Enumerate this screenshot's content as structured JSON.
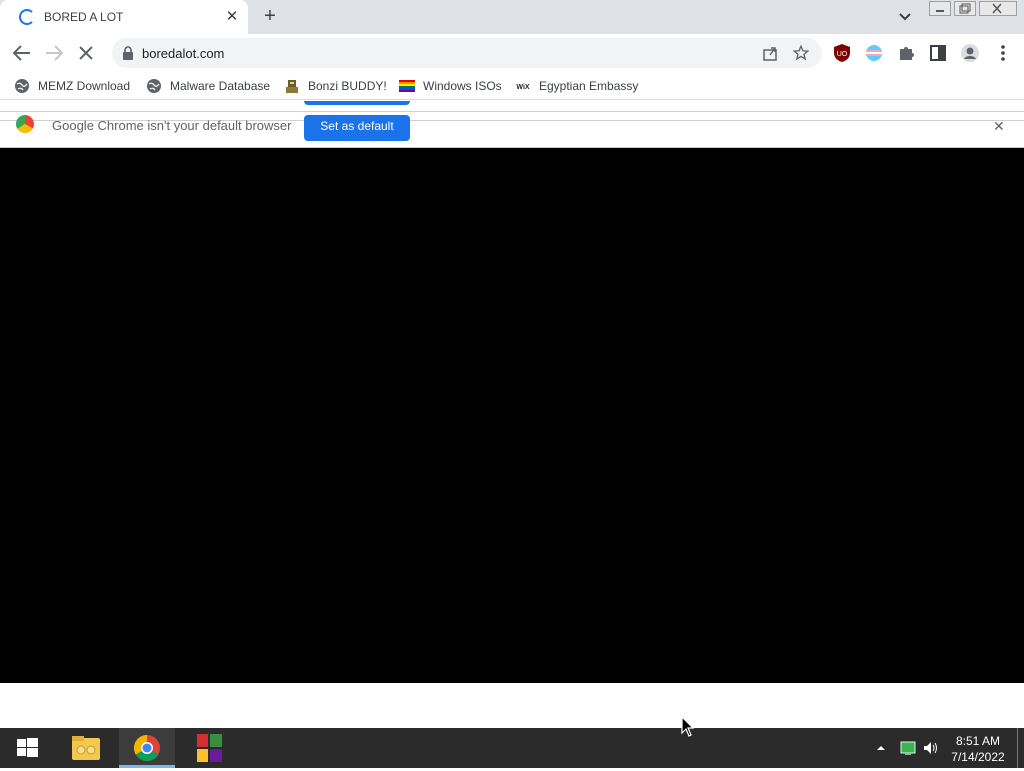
{
  "browser": {
    "tab": {
      "title": "BORED A LOT",
      "close": "✕"
    },
    "new_tab": "+",
    "address": {
      "url": "boredalot.com"
    },
    "bookmarks": [
      {
        "label": "MEMZ Download",
        "icon": "globe-icon"
      },
      {
        "label": "Malware Database",
        "icon": "globe-icon"
      },
      {
        "label": "Bonzi BUDDY!",
        "icon": "bonzi-icon"
      },
      {
        "label": "Windows ISOs",
        "icon": "rainbow-flag-icon"
      },
      {
        "label": "Egyptian Embassy",
        "icon": "wix-icon"
      }
    ],
    "infobar": {
      "message": "Google Chrome isn't your default browser",
      "button": "Set as default",
      "close": "✕"
    }
  },
  "taskbar": {
    "time": "8:51 AM",
    "date": "7/14/2022"
  },
  "colors": {
    "accent": "#1a73e8",
    "tabstrip": "#dee1e6",
    "page_content": "#000000",
    "taskbar": "#2b2b2b"
  }
}
